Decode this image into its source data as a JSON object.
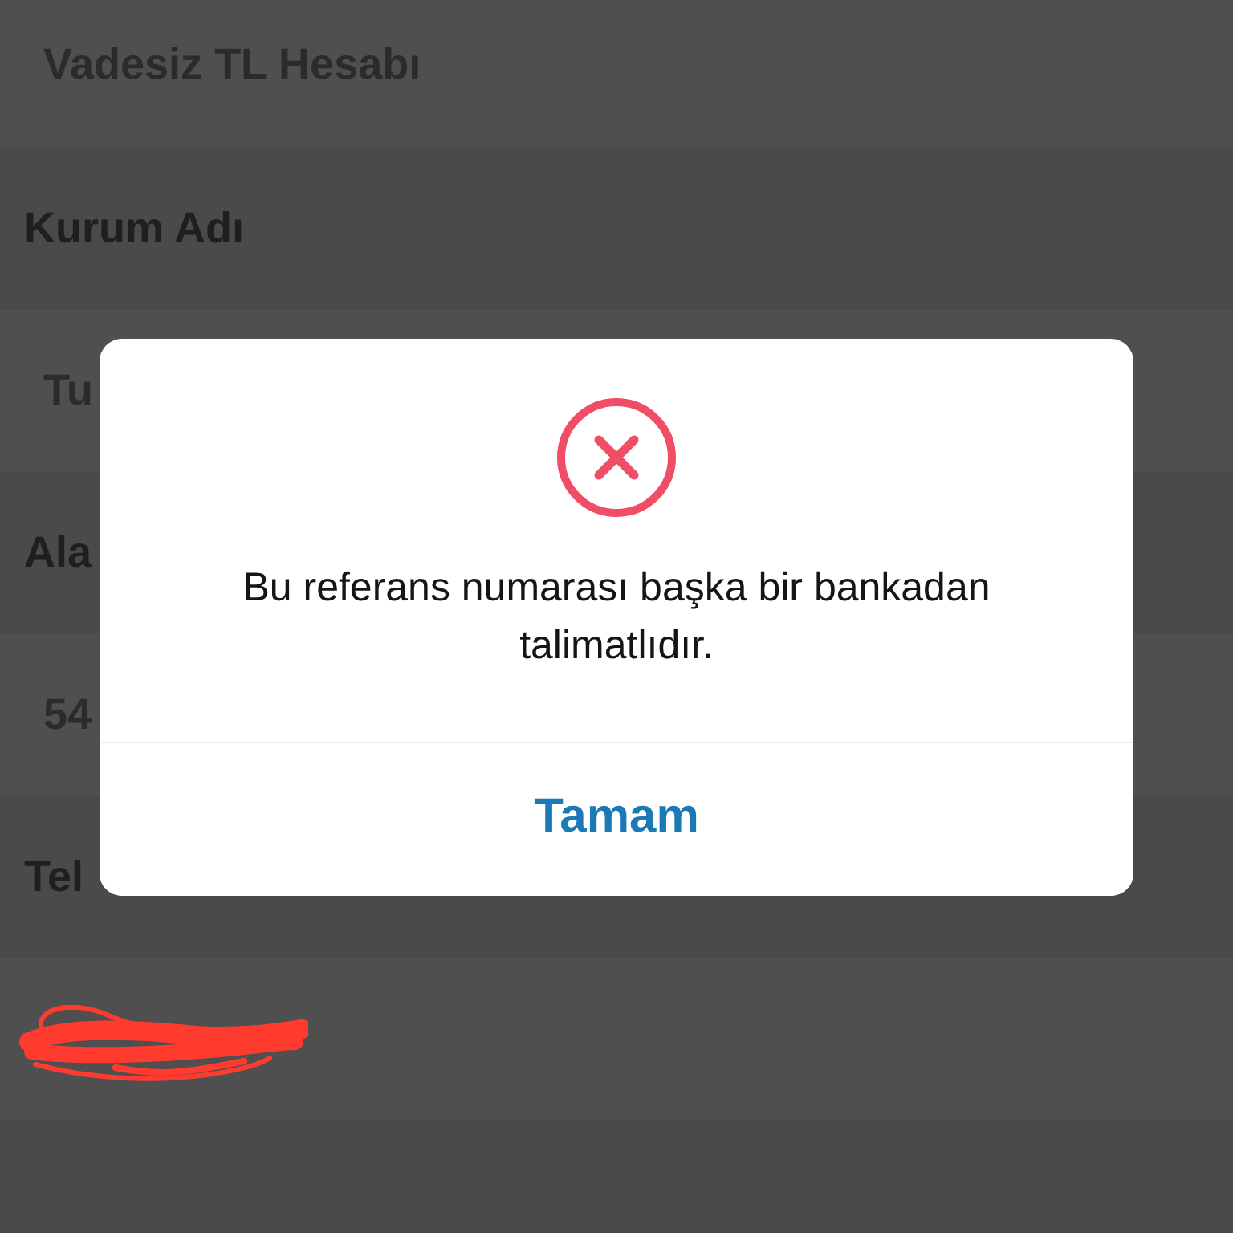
{
  "rows": [
    {
      "kind": "value",
      "text": "Vadesiz TL Hesabı",
      "redacted": false
    },
    {
      "kind": "label",
      "text": "Kurum Adı",
      "redacted": false
    },
    {
      "kind": "value",
      "text": "Tu",
      "redacted": false
    },
    {
      "kind": "label",
      "text": "Ala",
      "redacted": false
    },
    {
      "kind": "value",
      "text": "54",
      "redacted": false
    },
    {
      "kind": "label",
      "text": "Tel",
      "redacted": false
    },
    {
      "kind": "value",
      "redacted": true
    }
  ],
  "dialog": {
    "kind": "error",
    "message": "Bu referans numarası başka bir bankadan talimatlıdır.",
    "button": "Tamam"
  }
}
